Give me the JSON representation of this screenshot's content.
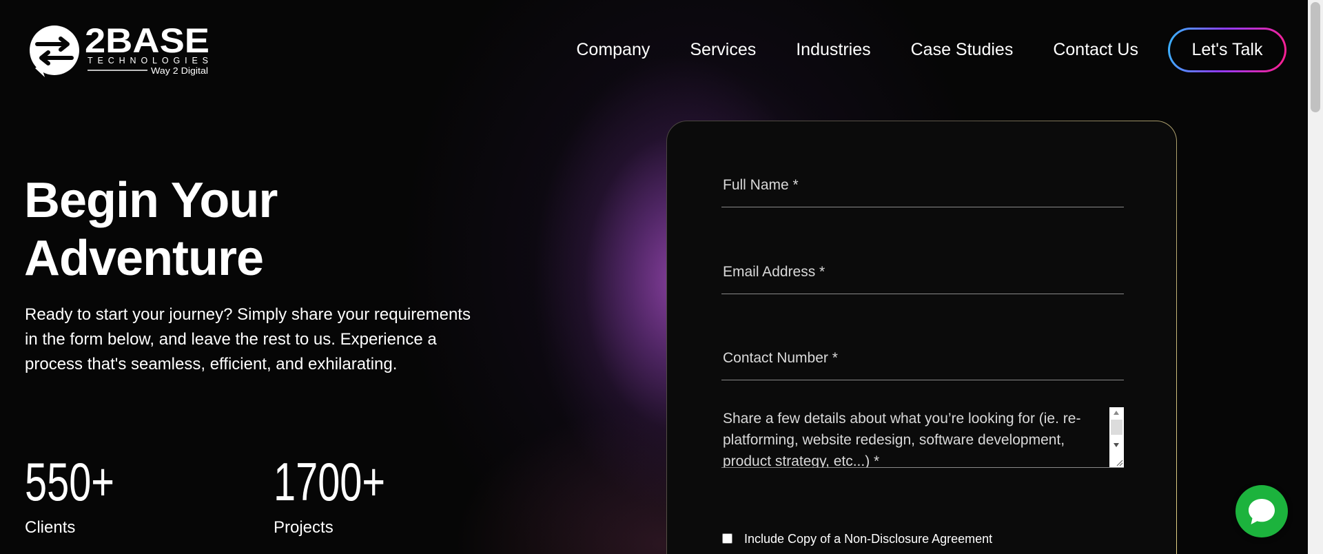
{
  "brand": {
    "name": "2BASE",
    "subtitle": "TECHNOLOGIES",
    "tagline": "Way 2 Digital"
  },
  "nav": {
    "items": [
      {
        "label": "Company"
      },
      {
        "label": "Services"
      },
      {
        "label": "Industries"
      },
      {
        "label": "Case Studies"
      },
      {
        "label": "Contact Us"
      }
    ],
    "cta_label": "Let's Talk"
  },
  "hero": {
    "title_line1": "Begin Your",
    "title_line2": "Adventure",
    "description": "Ready to start your journey? Simply share your requirements in the form below, and leave the rest to us. Experience a process that's seamless, efficient, and exhilarating."
  },
  "stats": [
    {
      "value": "550+",
      "label": "Clients"
    },
    {
      "value": "1700+",
      "label": "Projects"
    }
  ],
  "form": {
    "full_name_placeholder": "Full Name *",
    "email_placeholder": "Email Address *",
    "contact_placeholder": "Contact Number *",
    "details_placeholder": "Share a few details about what you’re looking for (ie. re-platforming, website redesign, software development, product strategy, etc...) *",
    "nda_label": "Include Copy of a Non-Disclosure Agreement",
    "nda_checked": false
  },
  "icons": {
    "logo_mark": "circular-arrows-icon",
    "chat": "chat-bubble-icon",
    "textarea_scroll_up": "scroll-up-arrow-icon",
    "textarea_scroll_down": "scroll-down-arrow-icon",
    "textarea_resize": "resize-grip-icon"
  },
  "colors": {
    "page_background": "#060606",
    "text": "#ffffff",
    "glow": "#9646af",
    "cta_gradient": [
      "#36b8ff",
      "#8d3dff",
      "#ff1e8c"
    ],
    "card_background": "#0b0b0b",
    "card_border_accent": "#e6d487",
    "field_underline": "#8a8a8a",
    "chat_button": "#1cb33d"
  }
}
